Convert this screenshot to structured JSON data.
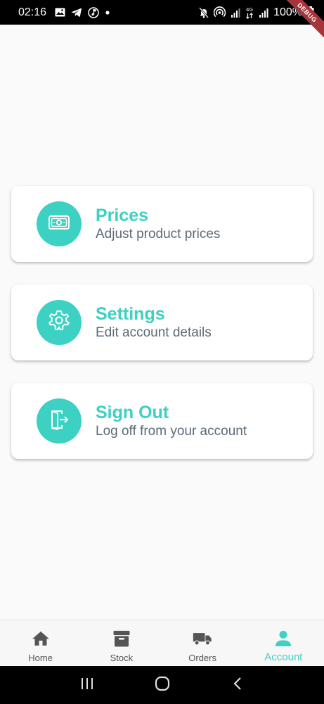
{
  "status_bar": {
    "time": "02:16",
    "battery": "100%",
    "debug_label": "DEBUG"
  },
  "menu": [
    {
      "title": "Prices",
      "subtitle": "Adjust product prices",
      "icon": "money-icon"
    },
    {
      "title": "Settings",
      "subtitle": "Edit account details",
      "icon": "gear-icon"
    },
    {
      "title": "Sign Out",
      "subtitle": "Log off from your account",
      "icon": "exit-door-icon"
    }
  ],
  "bottom_nav": {
    "items": [
      {
        "label": "Home",
        "icon": "home-icon",
        "active": false
      },
      {
        "label": "Stock",
        "icon": "archive-box-icon",
        "active": false
      },
      {
        "label": "Orders",
        "icon": "truck-icon",
        "active": false
      },
      {
        "label": "Account",
        "icon": "person-icon",
        "active": true
      }
    ]
  },
  "colors": {
    "accent": "#3cd1c2",
    "subtitle": "#5b6b78",
    "nav_inactive": "#555555"
  }
}
